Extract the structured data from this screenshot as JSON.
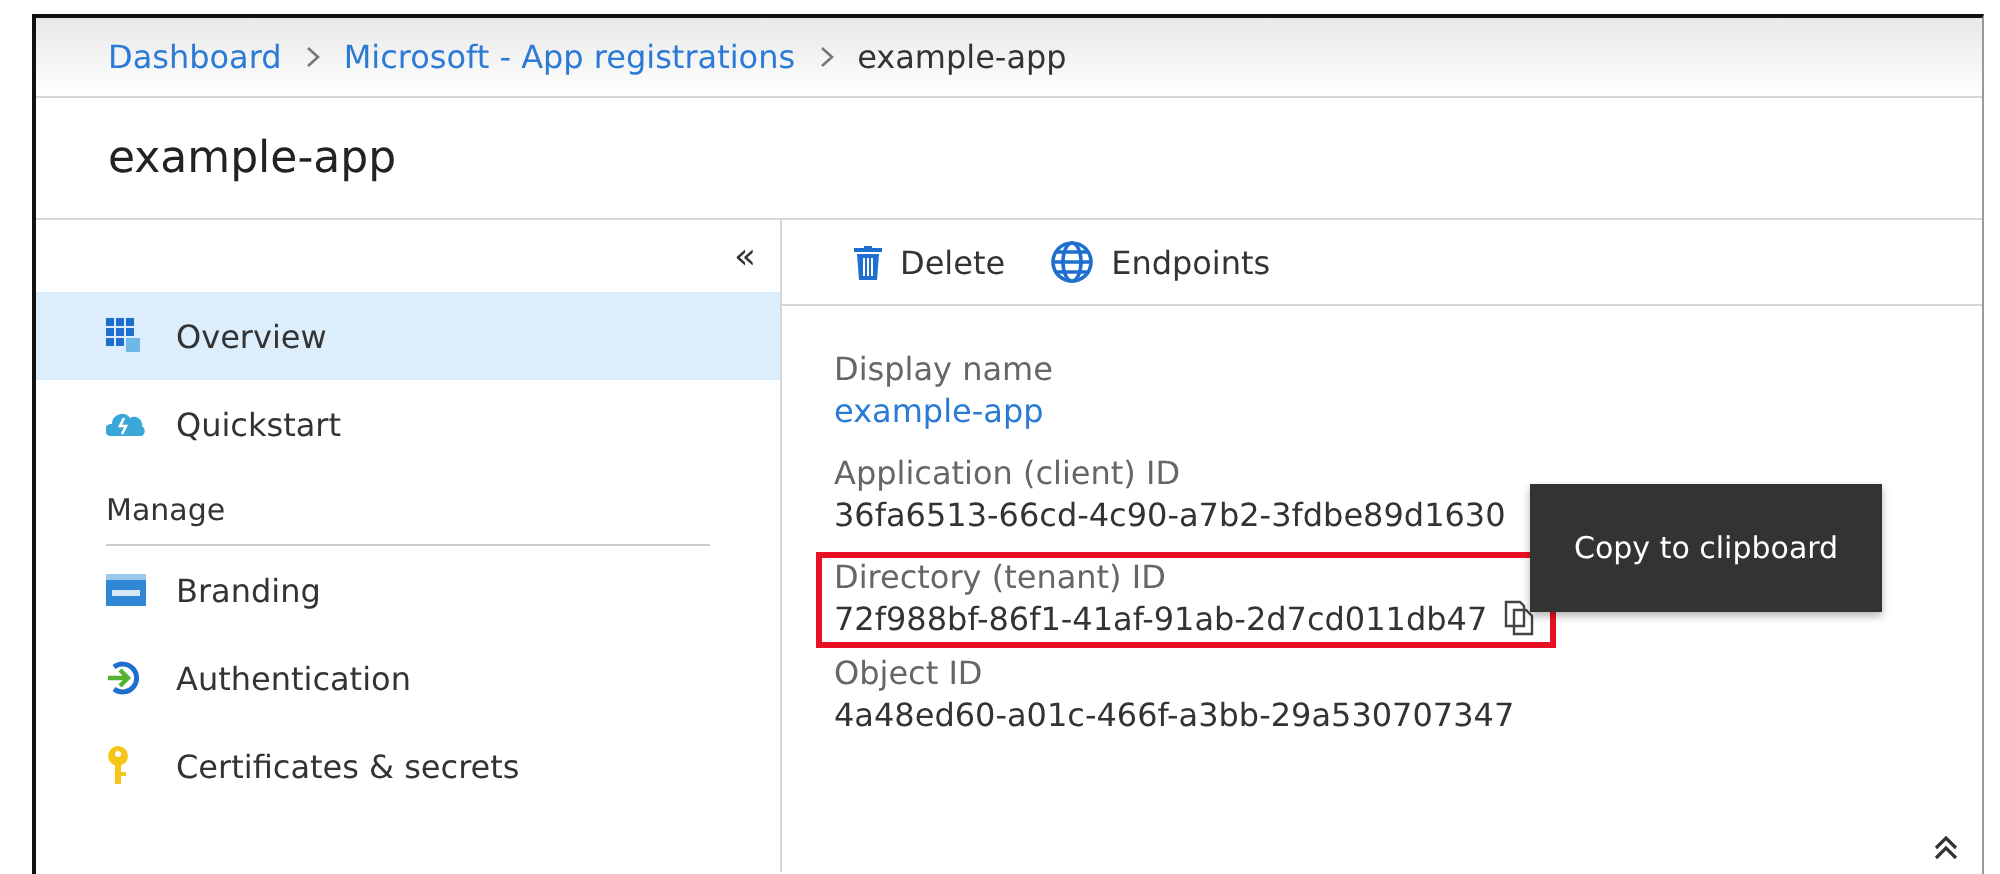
{
  "breadcrumb": [
    {
      "label": "Dashboard",
      "kind": "link"
    },
    {
      "label": "Microsoft - App registrations",
      "kind": "link"
    },
    {
      "label": "example-app",
      "kind": "current"
    }
  ],
  "title": "example-app",
  "sidebar": {
    "collapse": "«",
    "items": [
      {
        "kind": "item",
        "label": "Overview",
        "selected": true
      },
      {
        "kind": "item",
        "label": "Quickstart",
        "selected": false
      },
      {
        "kind": "header",
        "label": "Manage"
      },
      {
        "kind": "item",
        "label": "Branding",
        "selected": false
      },
      {
        "kind": "item",
        "label": "Authentication",
        "selected": false
      },
      {
        "kind": "item",
        "label": "Certificates & secrets",
        "selected": false
      }
    ]
  },
  "toolbar": [
    "Delete",
    "Endpoints"
  ],
  "properties": [
    {
      "label": "Display name",
      "value": "example-app",
      "kind": "link",
      "highlighted": false
    },
    {
      "label": "Application (client) ID",
      "value": "36fa6513-66cd-4c90-a7b2-3fdbe89d1630",
      "kind": "text",
      "highlighted": false
    },
    {
      "label": "Directory (tenant) ID",
      "value": "72f988bf-86f1-41af-91ab-2d7cd011db47",
      "kind": "text",
      "highlighted": true
    },
    {
      "label": "Object ID",
      "value": "4a48ed60-a01c-466f-a3bb-29a530707347",
      "kind": "text",
      "highlighted": false
    }
  ],
  "tooltip": "Copy to clipboard"
}
